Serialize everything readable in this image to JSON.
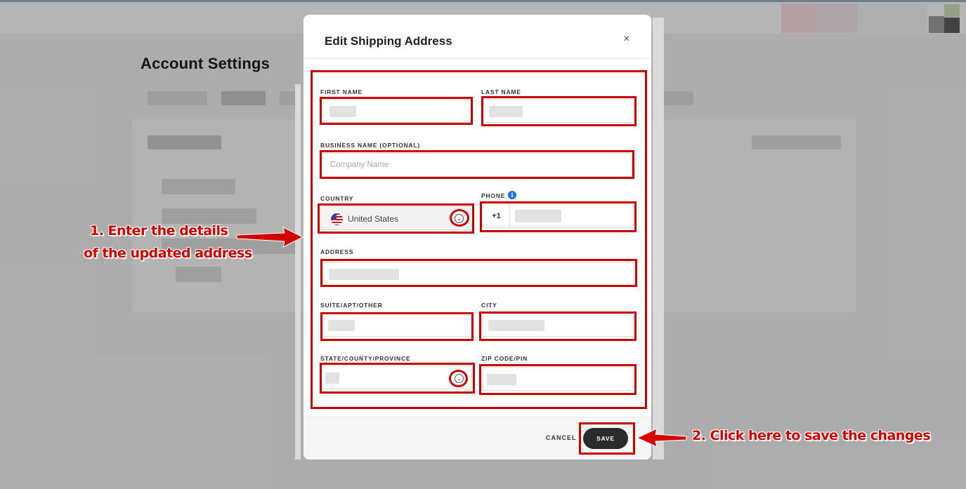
{
  "background": {
    "page_title": "Account Settings"
  },
  "modal": {
    "title": "Edit Shipping Address",
    "close_icon": "×",
    "fields": {
      "first_name": {
        "label": "FIRST NAME"
      },
      "last_name": {
        "label": "LAST NAME"
      },
      "business_name": {
        "label": "BUSINESS NAME (OPTIONAL)",
        "placeholder": "Company Name"
      },
      "country": {
        "label": "COUNTRY",
        "value": "United States",
        "icon": "us-flag-icon"
      },
      "phone": {
        "label": "PHONE",
        "prefix": "+1",
        "info_icon": "i"
      },
      "address": {
        "label": "ADDRESS"
      },
      "suite": {
        "label": "SUITE/APT/OTHER"
      },
      "city": {
        "label": "CITY"
      },
      "state": {
        "label": "STATE/COUNTY/PROVINCE"
      },
      "zip": {
        "label": "ZIP CODE/PIN"
      }
    },
    "footer": {
      "cancel_label": "CANCEL",
      "save_label": "SAVE"
    }
  },
  "annotations": {
    "step1_line1": "1. Enter the details",
    "step1_line2": "of the updated address",
    "step2": "2. Click here to save the changes",
    "highlight_color": "#cc0000"
  }
}
